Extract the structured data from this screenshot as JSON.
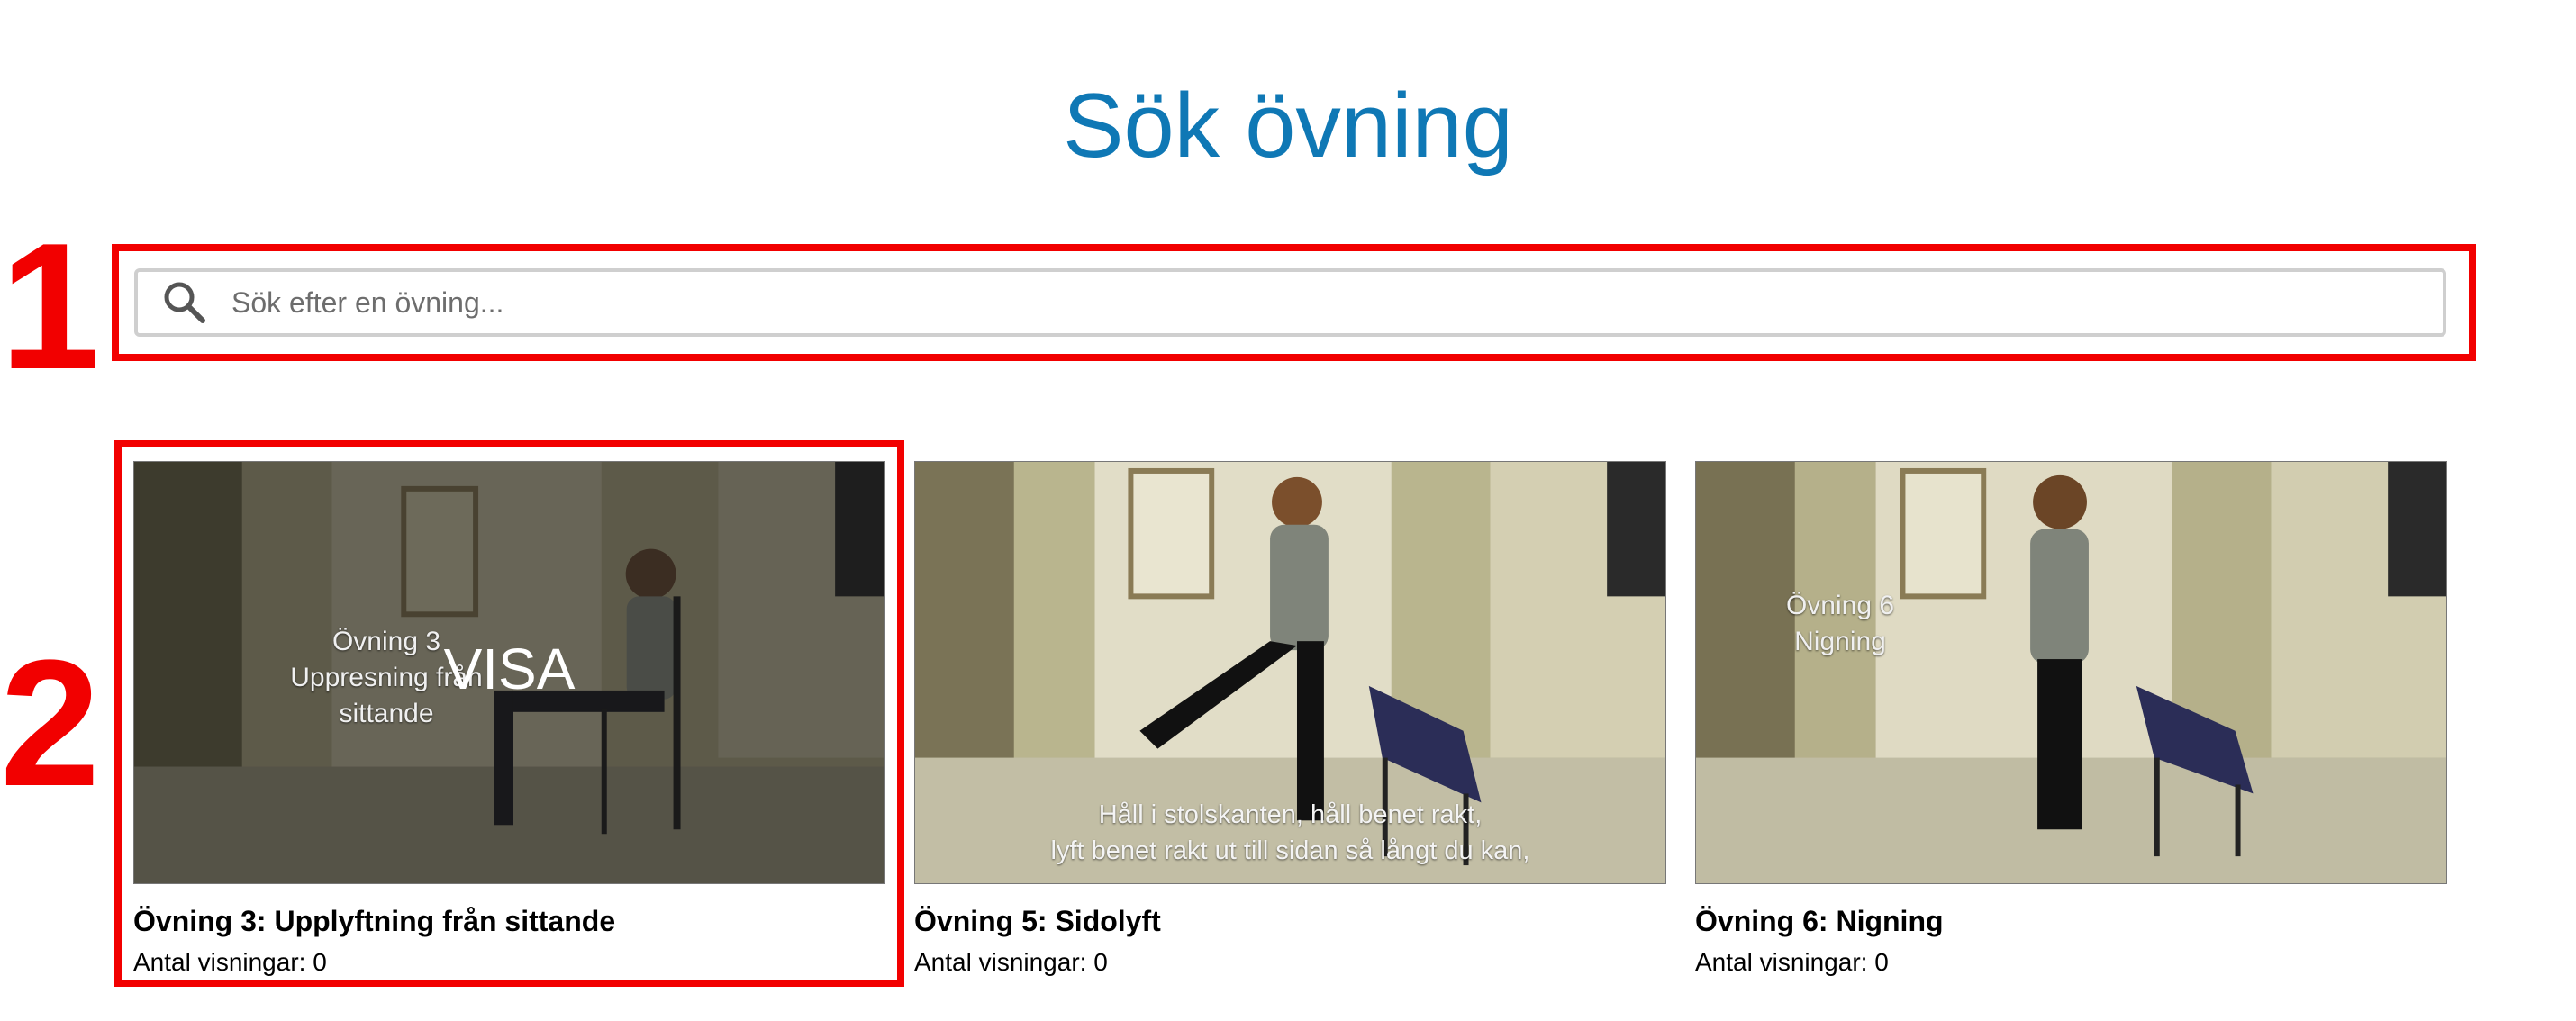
{
  "page": {
    "title": "Sök övning"
  },
  "annotations": [
    "1",
    "2"
  ],
  "search": {
    "placeholder": "Sök efter en övning...",
    "value": "",
    "icon": "search-icon"
  },
  "exercises": [
    {
      "title": "Övning 3: Upplyftning från sittande",
      "views": "Antal visningar: 0",
      "overlay_label": "VISA",
      "thumb_caption": [
        "Övning 3",
        "Uppresning från sittande"
      ],
      "thumb_subtitle": []
    },
    {
      "title": "Övning 5: Sidolyft",
      "views": "Antal visningar: 0",
      "overlay_label": "",
      "thumb_caption": [],
      "thumb_subtitle": [
        "Håll i stolskanten, håll benet rakt,",
        "lyft benet rakt ut till sidan så långt du kan,"
      ]
    },
    {
      "title": "Övning 6: Nigning",
      "views": "Antal visningar: 0",
      "overlay_label": "",
      "thumb_caption": [
        "Övning 6",
        "Nigning"
      ],
      "thumb_subtitle": []
    }
  ],
  "colors": {
    "title": "#0f78b5",
    "annotation": "#f20000",
    "search_border": "#cfcfcf"
  }
}
